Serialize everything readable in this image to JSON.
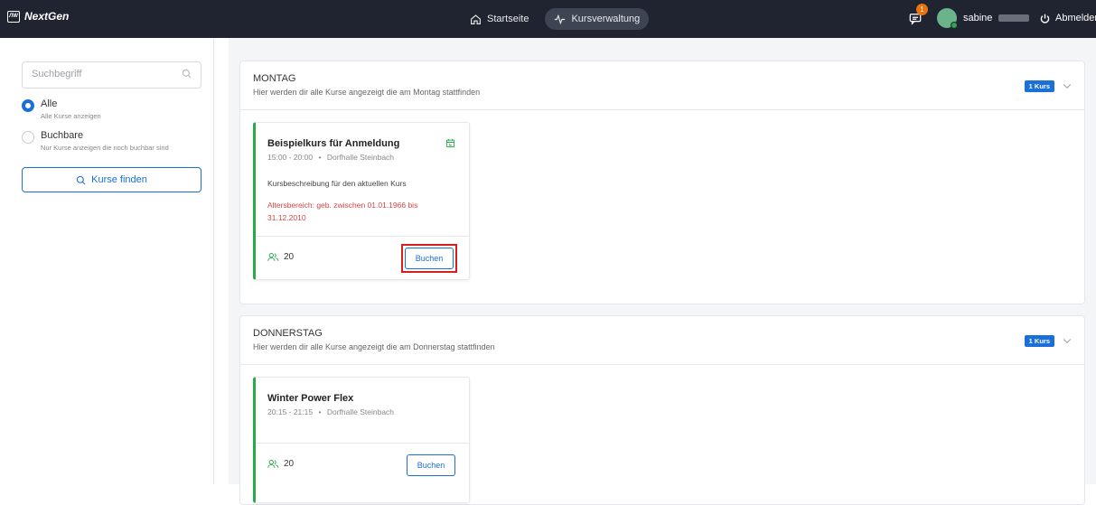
{
  "app": {
    "logo_mark": "ЛW",
    "name": "NextGen"
  },
  "nav": {
    "home": "Startseite",
    "courses": "Kursverwaltung"
  },
  "header": {
    "chat_count": "1",
    "user_name": "sabine",
    "logout": "Abmelden"
  },
  "sidebar": {
    "search_placeholder": "Suchbegriff",
    "filters": [
      {
        "label": "Alle",
        "sub": "Alle Kurse anzeigen",
        "checked": true
      },
      {
        "label": "Buchbare",
        "sub": "Nur Kurse anzeigen die noch buchbar sind",
        "checked": false
      }
    ],
    "find_button": "Kurse finden"
  },
  "days": [
    {
      "title": "MONTAG",
      "subtitle": "Hier werden dir alle Kurse angezeigt die am Montag stattfinden",
      "badge": "1 Kurs",
      "course": {
        "title": "Beispielkurs für Anmeldung",
        "time": "15:00 - 20:00",
        "separator": "•",
        "location": "Dorfhalle Steinbach",
        "description": "Kursbeschreibung für den aktuellen Kurs",
        "age_range": "Altersbereich: geb. zwischen 01.01.1966 bis 31.12.2010",
        "participants": "20",
        "book_label": "Buchen"
      }
    },
    {
      "title": "DONNERSTAG",
      "subtitle": "Hier werden dir alle Kurse angezeigt die am Donnerstag stattfinden",
      "badge": "1 Kurs",
      "course": {
        "title": "Winter Power Flex",
        "time": "20:15 - 21:15",
        "separator": "•",
        "location": "Dorfhalle Steinbach",
        "participants": "20",
        "book_label": "Buchen"
      }
    }
  ],
  "colors": {
    "topbar": "#1f2430",
    "accent": "#1a6fd8",
    "card_border": "#2aa84a",
    "warning": "#d24646",
    "highlight": "#d42020"
  }
}
